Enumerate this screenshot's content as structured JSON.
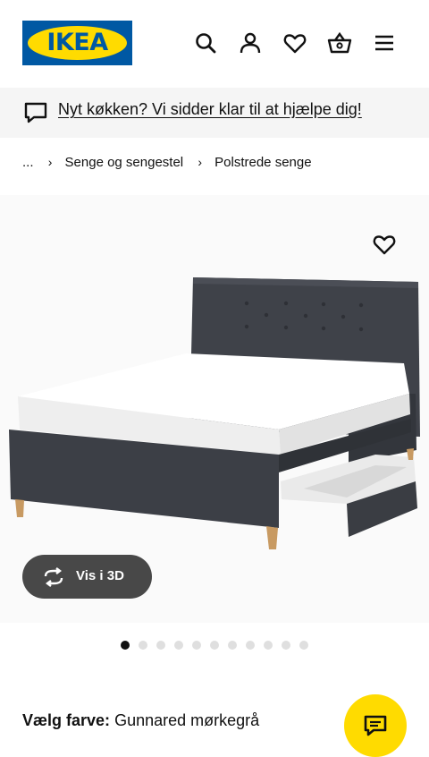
{
  "header": {
    "logo_text": "IKEA",
    "icons": [
      "search-icon",
      "account-icon",
      "heart-icon",
      "basket-icon",
      "menu-icon"
    ]
  },
  "banner": {
    "icon": "chat-bubble-icon",
    "link_text": "Nyt køkken? Vi sidder klar til at hjælpe dig!"
  },
  "breadcrumb": {
    "items": [
      "...",
      "Senge og sengestel",
      "Polstrede senge"
    ]
  },
  "gallery": {
    "view3d_label": "Vis i 3D",
    "dot_count": 11,
    "active_dot": 0
  },
  "product": {
    "color_label": "Vælg farve:",
    "color_value": "Gunnared mørkegrå"
  },
  "colors": {
    "ikea_blue": "#0058a3",
    "ikea_yellow": "#ffdb00"
  }
}
